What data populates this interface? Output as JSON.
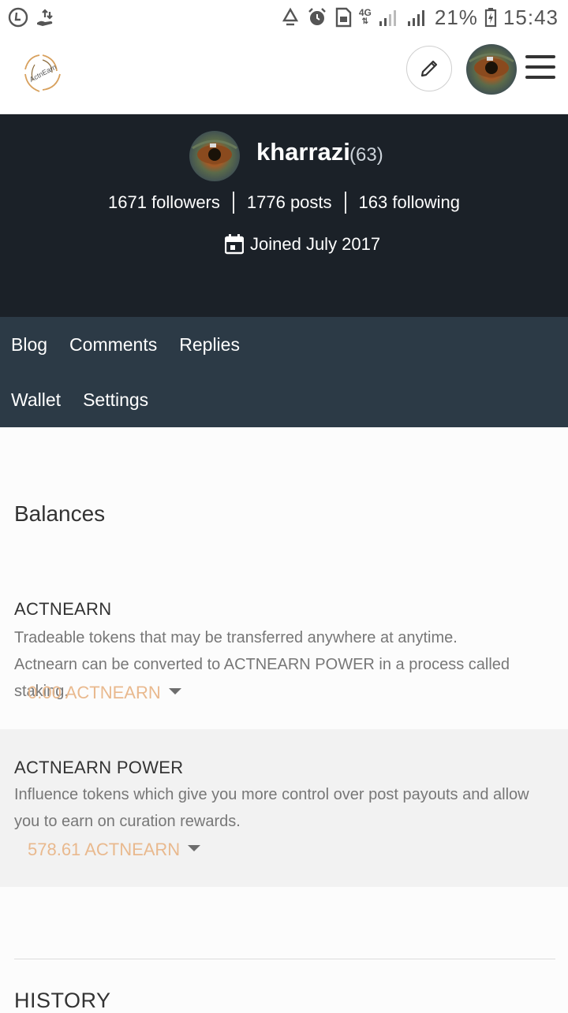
{
  "status": {
    "network": "4G",
    "battery": "21%",
    "time": "15:43"
  },
  "header": {
    "logo_text": "ActnEarn"
  },
  "profile": {
    "username": "kharrazi",
    "reputation": "(63)",
    "followers": "1671 followers",
    "posts": "1776 posts",
    "following": "163 following",
    "joined": "Joined July 2017"
  },
  "nav": {
    "row1": [
      "Blog",
      "Comments",
      "Replies"
    ],
    "row2": [
      "Wallet",
      "Settings"
    ]
  },
  "balances": {
    "title": "Balances",
    "actnearn": {
      "title": "ACTNEARN",
      "desc1": "Tradeable tokens that may be transferred anywhere at anytime.",
      "desc2": "Actnearn can be converted to ACTNEARN POWER in a process called staking.",
      "amount": "0.00 ACTNEARN"
    },
    "power": {
      "title": "ACTNEARN POWER",
      "desc": "Influence tokens which give you more control over post payouts and allow you to earn on curation rewards.",
      "amount": "578.61 ACTNEARN"
    }
  },
  "history": {
    "title": "HISTORY"
  },
  "colors": {
    "banner": "#1b2128",
    "nav": "#2c3a46",
    "amount": "#e9b98e"
  }
}
